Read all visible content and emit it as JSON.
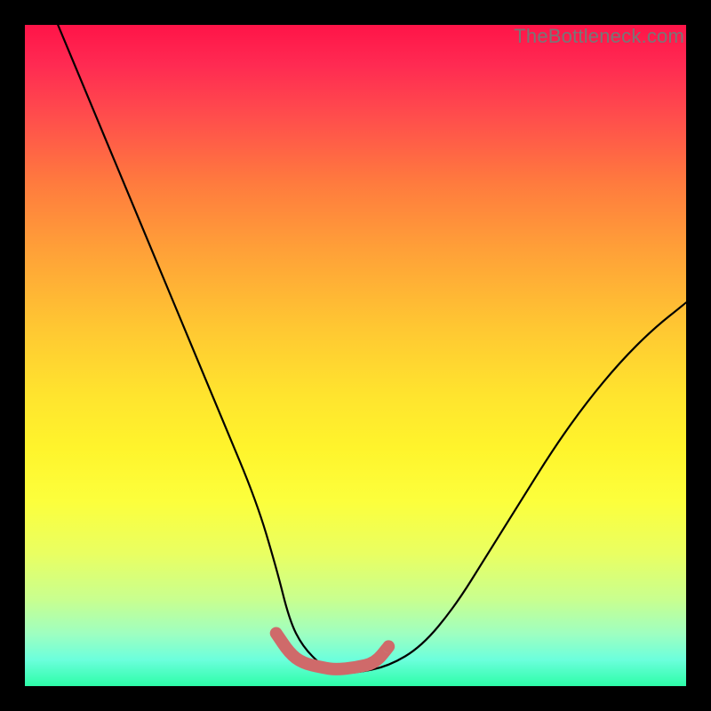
{
  "watermark": "TheBottleneck.com",
  "chart_data": {
    "type": "line",
    "title": "",
    "xlabel": "",
    "ylabel": "",
    "xlim": [
      0,
      100
    ],
    "ylim": [
      0,
      100
    ],
    "grid": false,
    "legend": false,
    "series": [
      {
        "name": "bottleneck-curve",
        "color": "#000000",
        "x": [
          5,
          10,
          15,
          20,
          25,
          30,
          35,
          38,
          40,
          42,
          45,
          47,
          50,
          55,
          60,
          65,
          70,
          75,
          80,
          85,
          90,
          95,
          100
        ],
        "y": [
          100,
          88,
          76,
          64,
          52,
          40,
          28,
          18,
          10,
          6,
          3,
          2,
          2,
          3,
          6,
          12,
          20,
          28,
          36,
          43,
          49,
          54,
          58
        ]
      },
      {
        "name": "optimal-zone",
        "color": "#cf6a6a",
        "x": [
          38,
          40,
          42,
          45,
          47,
          50,
          53,
          55
        ],
        "y": [
          8,
          5,
          3.5,
          2.8,
          2.5,
          2.8,
          3.5,
          6
        ]
      }
    ],
    "gradient_stops": [
      {
        "pos": 0,
        "color": "#ff1448"
      },
      {
        "pos": 50,
        "color": "#ffe42e"
      },
      {
        "pos": 100,
        "color": "#2dfda8"
      }
    ]
  }
}
